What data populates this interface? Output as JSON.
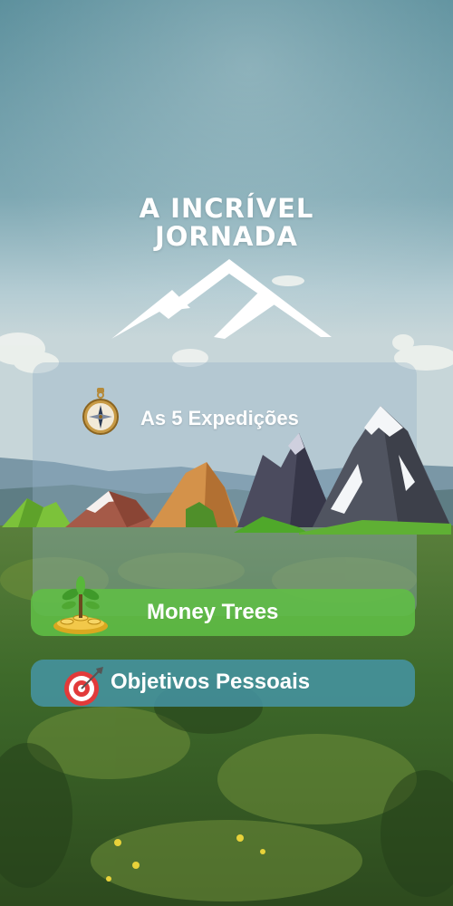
{
  "header": {
    "title_line1": "A INCRÍVEL",
    "title_line2": "JORNADA"
  },
  "expeditions": {
    "label": "As 5 Expedições",
    "icon": "compass-icon"
  },
  "buttons": [
    {
      "label": "Money Trees",
      "icon": "money-tree-icon",
      "color": "#60be46"
    },
    {
      "label": "Objetivos Pessoais",
      "icon": "target-icon",
      "color": "#4696aa"
    }
  ],
  "colors": {
    "sky_top": "#5f93a0",
    "sky_bottom": "#b9d0d6",
    "forest": "#3f6b2a"
  }
}
